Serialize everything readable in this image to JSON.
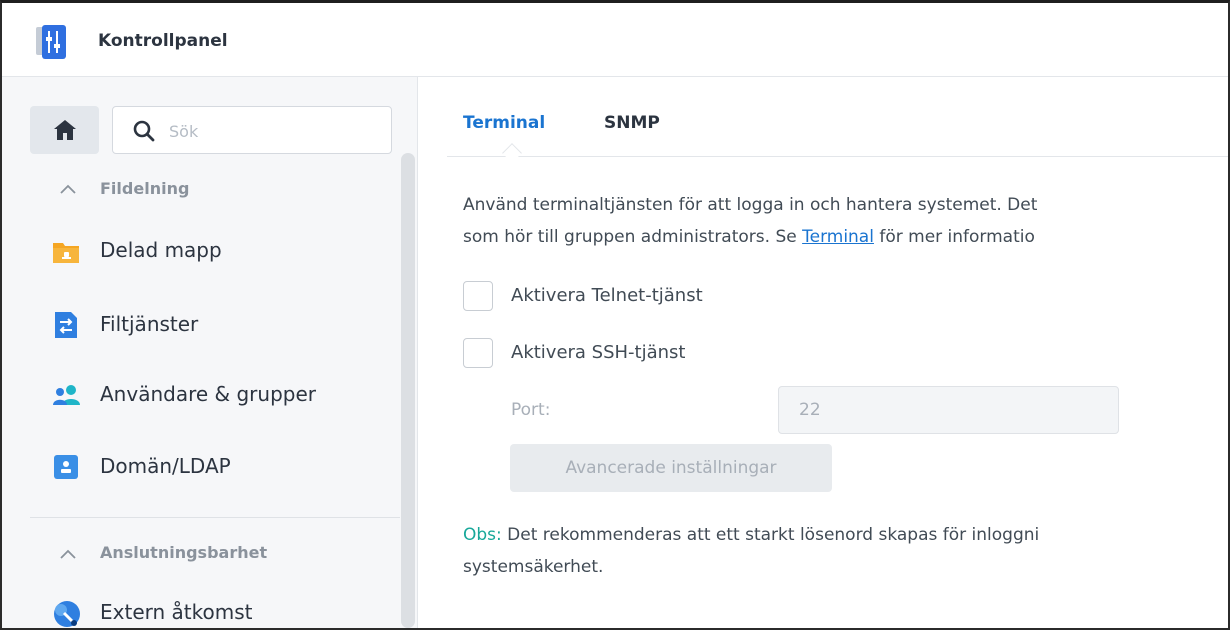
{
  "window": {
    "title": "Kontrollpanel",
    "icon": "control-panel-icon"
  },
  "sidebar": {
    "home_icon": "home-icon",
    "search": {
      "placeholder": "Sök",
      "value": "",
      "icon": "search-icon"
    },
    "groups": [
      {
        "label": "Fildelning",
        "icon": "chevron-up-icon",
        "items": [
          {
            "label": "Delad mapp",
            "icon": "shared-folder-icon",
            "color": "#f5a623"
          },
          {
            "label": "Filtjänster",
            "icon": "file-services-icon",
            "color": "#2f7fe0"
          },
          {
            "label": "Användare & grupper",
            "icon": "users-groups-icon",
            "color": "#1fb5c8"
          },
          {
            "label": "Domän/LDAP",
            "icon": "domain-ldap-icon",
            "color": "#3a8fe6"
          }
        ]
      },
      {
        "label": "Anslutningsbarhet",
        "icon": "chevron-up-icon",
        "items": [
          {
            "label": "Extern åtkomst",
            "icon": "external-access-icon",
            "color": "#2f7fe0"
          }
        ]
      }
    ]
  },
  "main": {
    "tabs": [
      {
        "label": "Terminal",
        "active": true
      },
      {
        "label": "SNMP",
        "active": false
      }
    ],
    "description": {
      "line1": "Använd terminaltjänsten för att logga in och hantera systemet. Det",
      "line2_before": "som hör till gruppen administrators. Se ",
      "line2_link": "Terminal",
      "line2_after": " för mer informatio"
    },
    "telnet": {
      "label": "Aktivera Telnet-tjänst",
      "checked": false
    },
    "ssh": {
      "label": "Aktivera SSH-tjänst",
      "checked": false
    },
    "port": {
      "label": "Port:",
      "value": "22"
    },
    "advanced_button": "Avancerade inställningar",
    "note": {
      "prefix": "Obs:",
      "line1": " Det rekommenderas att ett starkt lösenord skapas för inloggni",
      "line2": "systemsäkerhet."
    }
  },
  "colors": {
    "accent": "#1a74d0",
    "note": "#18a89a",
    "disabled_text": "#a8afb8"
  }
}
